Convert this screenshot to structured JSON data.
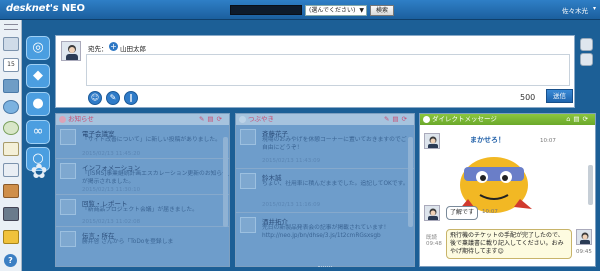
{
  "app": {
    "logo": "desknet's",
    "logo_suffix": "NEO",
    "user": "佐々木光"
  },
  "search": {
    "placeholder": "",
    "scope": "(選んでください)",
    "button": "検索"
  },
  "compose": {
    "dest_label": "宛先：",
    "dest_name": "山田太郎",
    "char_count": "500",
    "send_label": "送信"
  },
  "panels": {
    "info": {
      "title": "お知らせ",
      "items": [
        {
          "title": "電子会議室",
          "text": "「サイト改善について」に新しい投稿がありました。",
          "meta": "2015/02/13 11:45:20"
        },
        {
          "title": "インフォメーション",
          "text": "「[ISMS]事業継続計画エスカレーション更新のお知らせ」が掲示されました。",
          "meta": "2015/02/13 11:30:10"
        },
        {
          "title": "回覧・レポート",
          "text": "「新商品プロジェクト会議」が届きました。",
          "meta": "2015/02/13 11:02:08"
        },
        {
          "title": "伝言・所在",
          "text": "勝井啓 さんから「ToDoを登録しま",
          "meta": ""
        }
      ]
    },
    "chat": {
      "title": "つぶやき",
      "items": [
        {
          "name": "斉藤花子",
          "text": "現場のおみやげを休憩コーナーに置いておきますのでご自由にどうぞ！",
          "meta": "2015/02/13 11:43:09"
        },
        {
          "name": "鈴木誠",
          "text": "ちょい、社用車に積んだままでした。追記してOKです。",
          "meta": "2015/02/13 11:16:09"
        },
        {
          "name": "酒井拓介",
          "text": "先日の新製品発表会の記事が掲載されています！ http://neo.jp/bn/dhse/3.js/1t2cmRGsxsgb",
          "meta": ""
        }
      ]
    },
    "dm": {
      "title": "ダイレクトメッセージ",
      "sticker_text": "まかせろ！",
      "time1": "10:07",
      "reply": "了解です",
      "time2": "10:07",
      "reply_meta_label": "既読",
      "reply_meta_time": "09:48",
      "message": "飛行機のチケットの手配が完了したので、後で稟議書に載り記入してください。おみやげ期待してます😊",
      "time3": "09:45"
    }
  },
  "colors": {
    "topbar": "#1f67aa",
    "background": "#1c5f96",
    "dim_panel": "#6e9dcb",
    "dm_header": "#7bb936",
    "send_button": "#2a77c4"
  },
  "icons": {
    "rail": [
      "menu-icon",
      "portal-icon",
      "calendar-icon",
      "desktop-icon",
      "download-icon",
      "recycle-icon",
      "notes-icon",
      "report-icon",
      "folder-icon",
      "folder-icon",
      "help-icon"
    ],
    "apps": [
      "broadcast-icon",
      "chat-icon",
      "person-icon",
      "chat-bubbles-icon",
      "search-icon",
      "gear-icon"
    ]
  }
}
